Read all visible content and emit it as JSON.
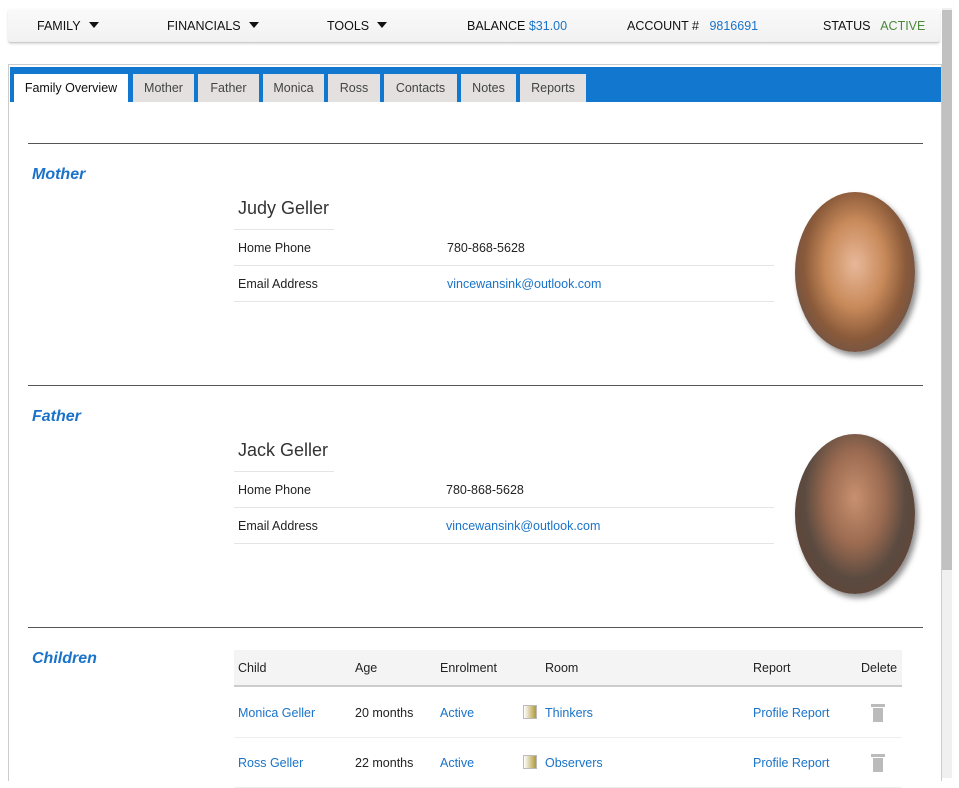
{
  "topbar": {
    "family": "FAMILY",
    "financials": "FINANCIALS",
    "tools": "TOOLS",
    "balance_label": "BALANCE",
    "balance_value": "$31.00",
    "account_label": "ACCOUNT #",
    "account_value": "9816691",
    "status_label": "STATUS",
    "status_value": "ACTIVE"
  },
  "tabs": [
    "Family Overview",
    "Mother",
    "Father",
    "Monica",
    "Ross",
    "Contacts",
    "Notes",
    "Reports"
  ],
  "mother": {
    "heading": "Mother",
    "name": "Judy Geller",
    "phone_label": "Home Phone",
    "phone": "780-868-5628",
    "email_label": "Email Address",
    "email": "vincewansink@outlook.com"
  },
  "father": {
    "heading": "Father",
    "name": "Jack Geller",
    "phone_label": "Home Phone",
    "phone": "780-868-5628",
    "email_label": "Email Address",
    "email": "vincewansink@outlook.com"
  },
  "children": {
    "heading": "Children",
    "columns": [
      "Child",
      "Age",
      "Enrolment",
      "Room",
      "Report",
      "Delete"
    ],
    "rows": [
      {
        "child": "Monica Geller",
        "age": "20 months",
        "enrolment": "Active",
        "room": "Thinkers",
        "report": "Profile Report"
      },
      {
        "child": "Ross Geller",
        "age": "22 months",
        "enrolment": "Active",
        "room": "Observers",
        "report": "Profile Report"
      }
    ]
  },
  "colors": {
    "accent": "#1277cf",
    "link": "#1a73c9",
    "status_active": "#4a8a3a"
  }
}
